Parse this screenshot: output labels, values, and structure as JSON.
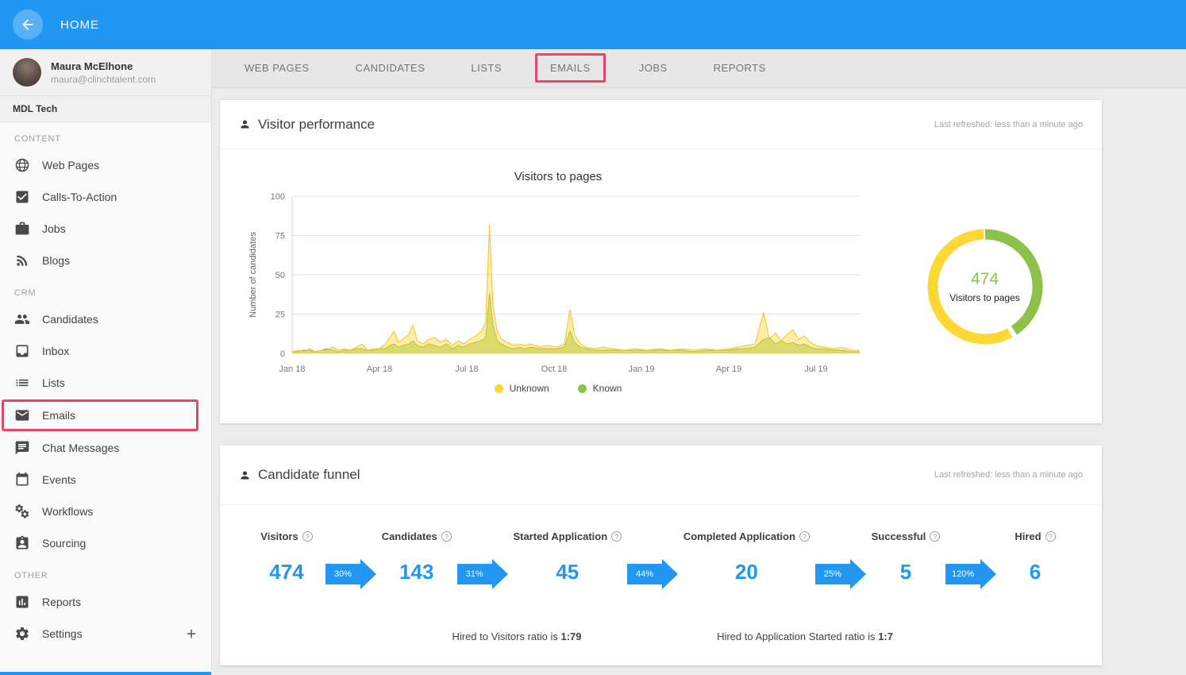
{
  "topbar": {
    "title": "HOME"
  },
  "sidebar": {
    "user": {
      "name": "Maura McElhone",
      "email": "maura@clinchtalent.com"
    },
    "company": "MDL Tech",
    "sections": [
      {
        "label": "CONTENT",
        "items": [
          {
            "label": "Web Pages",
            "icon": "globe"
          },
          {
            "label": "Calls-To-Action",
            "icon": "check"
          },
          {
            "label": "Jobs",
            "icon": "briefcase"
          },
          {
            "label": "Blogs",
            "icon": "rss"
          }
        ]
      },
      {
        "label": "CRM",
        "items": [
          {
            "label": "Candidates",
            "icon": "people"
          },
          {
            "label": "Inbox",
            "icon": "inbox"
          },
          {
            "label": "Lists",
            "icon": "list"
          },
          {
            "label": "Emails",
            "icon": "envelope",
            "active": true
          },
          {
            "label": "Chat Messages",
            "icon": "chat"
          },
          {
            "label": "Events",
            "icon": "calendar"
          },
          {
            "label": "Workflows",
            "icon": "workflows"
          },
          {
            "label": "Sourcing",
            "icon": "sourcing"
          }
        ]
      },
      {
        "label": "OTHER",
        "items": [
          {
            "label": "Reports",
            "icon": "reports"
          },
          {
            "label": "Settings",
            "icon": "gear",
            "trailing": "plus"
          }
        ]
      }
    ]
  },
  "tabs": [
    {
      "label": "WEB PAGES"
    },
    {
      "label": "CANDIDATES"
    },
    {
      "label": "LISTS"
    },
    {
      "label": "EMAILS",
      "active": true
    },
    {
      "label": "JOBS"
    },
    {
      "label": "REPORTS"
    }
  ],
  "visitor_performance": {
    "title": "Visitor performance",
    "last_refreshed": "Last refreshed: less than a minute ago",
    "donut": {
      "value": "474",
      "label": "Visitors to pages",
      "known_deg": 150,
      "known_color": "#8bc34a",
      "unknown_color": "#fdd835"
    }
  },
  "candidate_funnel": {
    "title": "Candidate funnel",
    "last_refreshed": "Last refreshed: less than a minute ago",
    "info_glyph": "?",
    "stages": [
      {
        "label": "Visitors",
        "value": "474"
      },
      {
        "label": "Candidates",
        "value": "143"
      },
      {
        "label": "Started Application",
        "value": "45"
      },
      {
        "label": "Completed Application",
        "value": "20"
      },
      {
        "label": "Successful",
        "value": "5"
      },
      {
        "label": "Hired",
        "value": "6"
      }
    ],
    "conversions": [
      "30%",
      "31%",
      "44%",
      "25%",
      "120%"
    ],
    "ratios": [
      {
        "text": "Hired to Visitors ratio is ",
        "value": "1:79"
      },
      {
        "text": "Hired to Application Started ratio is ",
        "value": "1:7"
      }
    ]
  },
  "chart_data": {
    "type": "area",
    "title": "Visitors to pages",
    "ylabel": "Number of candidates",
    "ylim": [
      0,
      100
    ],
    "yticks": [
      0,
      25,
      50,
      75,
      100
    ],
    "xlim": [
      0,
      19.5
    ],
    "xticks": [
      {
        "m": 0,
        "label": "Jan 18"
      },
      {
        "m": 3,
        "label": "Apr 18"
      },
      {
        "m": 6,
        "label": "Jul 18"
      },
      {
        "m": 9,
        "label": "Oct 18"
      },
      {
        "m": 12,
        "label": "Jan 19"
      },
      {
        "m": 15,
        "label": "Apr 19"
      },
      {
        "m": 18,
        "label": "Jul 19"
      }
    ],
    "series": [
      {
        "name": "Unknown",
        "color": "#fbc02d",
        "fill": "rgba(253,216,53,0.45)",
        "point_index": 1
      },
      {
        "name": "Known",
        "color": "#7cb342",
        "fill": "rgba(139,195,74,0.55)",
        "point_index": 2
      }
    ],
    "points": [
      [
        0,
        1,
        1
      ],
      [
        0.2,
        2,
        1
      ],
      [
        0.4,
        1,
        2
      ],
      [
        0.6,
        3,
        2
      ],
      [
        0.8,
        1,
        1
      ],
      [
        1.0,
        2,
        2
      ],
      [
        1.2,
        2,
        3
      ],
      [
        1.4,
        4,
        2
      ],
      [
        1.6,
        2,
        1
      ],
      [
        1.8,
        3,
        2
      ],
      [
        2.0,
        2,
        2
      ],
      [
        2.2,
        4,
        3
      ],
      [
        2.4,
        6,
        3
      ],
      [
        2.6,
        2,
        2
      ],
      [
        2.8,
        3,
        2
      ],
      [
        3.0,
        3,
        3
      ],
      [
        3.2,
        6,
        3
      ],
      [
        3.35,
        10,
        5
      ],
      [
        3.5,
        14,
        6
      ],
      [
        3.65,
        7,
        4
      ],
      [
        3.8,
        9,
        5
      ],
      [
        4.0,
        12,
        6
      ],
      [
        4.15,
        18,
        8
      ],
      [
        4.3,
        8,
        5
      ],
      [
        4.5,
        6,
        4
      ],
      [
        4.7,
        9,
        6
      ],
      [
        4.9,
        10,
        5
      ],
      [
        5.1,
        7,
        4
      ],
      [
        5.3,
        9,
        6
      ],
      [
        5.5,
        5,
        3
      ],
      [
        5.7,
        8,
        5
      ],
      [
        5.9,
        6,
        4
      ],
      [
        6.1,
        9,
        6
      ],
      [
        6.3,
        11,
        7
      ],
      [
        6.5,
        14,
        8
      ],
      [
        6.65,
        20,
        10
      ],
      [
        6.78,
        82,
        38
      ],
      [
        6.9,
        30,
        18
      ],
      [
        7.05,
        14,
        8
      ],
      [
        7.2,
        9,
        6
      ],
      [
        7.4,
        7,
        4
      ],
      [
        7.6,
        5,
        3
      ],
      [
        7.8,
        6,
        4
      ],
      [
        8.0,
        5,
        3
      ],
      [
        8.2,
        6,
        4
      ],
      [
        8.5,
        4,
        3
      ],
      [
        8.8,
        5,
        3
      ],
      [
        9.1,
        4,
        3
      ],
      [
        9.35,
        6,
        4
      ],
      [
        9.55,
        28,
        14
      ],
      [
        9.7,
        12,
        7
      ],
      [
        9.9,
        6,
        4
      ],
      [
        10.1,
        4,
        3
      ],
      [
        10.4,
        3,
        2
      ],
      [
        10.7,
        4,
        2
      ],
      [
        11.0,
        3,
        2
      ],
      [
        11.4,
        2,
        2
      ],
      [
        11.8,
        3,
        2
      ],
      [
        12.2,
        2,
        2
      ],
      [
        12.6,
        3,
        2
      ],
      [
        13.0,
        2,
        2
      ],
      [
        13.4,
        3,
        2
      ],
      [
        13.8,
        2,
        1
      ],
      [
        14.2,
        3,
        2
      ],
      [
        14.6,
        2,
        2
      ],
      [
        15.0,
        3,
        2
      ],
      [
        15.3,
        4,
        3
      ],
      [
        15.6,
        5,
        3
      ],
      [
        15.9,
        6,
        4
      ],
      [
        16.2,
        26,
        9
      ],
      [
        16.4,
        9,
        10
      ],
      [
        16.6,
        13,
        6
      ],
      [
        16.8,
        8,
        8
      ],
      [
        17.0,
        12,
        6
      ],
      [
        17.2,
        15,
        7
      ],
      [
        17.4,
        9,
        5
      ],
      [
        17.6,
        11,
        6
      ],
      [
        17.8,
        7,
        4
      ],
      [
        18.0,
        5,
        3
      ],
      [
        18.3,
        4,
        3
      ],
      [
        18.6,
        3,
        2
      ],
      [
        18.9,
        4,
        2
      ],
      [
        19.2,
        2,
        1
      ],
      [
        19.5,
        2,
        1
      ]
    ],
    "legend_position": "bottom",
    "grid": true
  },
  "colors": {
    "accent_blue": "#2196f3",
    "highlight_pink": "#ee4266",
    "unknown_yellow": "#fdd835",
    "known_green": "#8bc34a"
  }
}
